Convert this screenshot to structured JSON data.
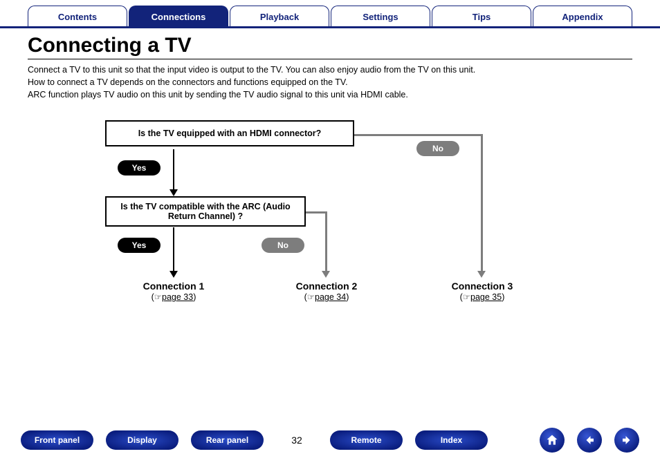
{
  "tabs": {
    "t0": "Contents",
    "t1": "Connections",
    "t2": "Playback",
    "t3": "Settings",
    "t4": "Tips",
    "t5": "Appendix",
    "active_index": 1
  },
  "heading": "Connecting a TV",
  "intro": {
    "p1": "Connect a TV to this unit so that the input video is output to the TV. You can also enjoy audio from the TV on this unit.",
    "p2": "How to connect a TV depends on the connectors and functions equipped on the TV.",
    "p3": "ARC function plays TV audio on this unit by sending the TV audio signal to this unit via HDMI cable."
  },
  "flow": {
    "q1": "Is the TV equipped with an HDMI connector?",
    "q2": "Is the TV compatible with the ARC (Audio Return Channel) ?",
    "yes": "Yes",
    "no": "No",
    "conn1_title": "Connection 1",
    "conn1_link": "page 33",
    "conn2_title": "Connection 2",
    "conn2_link": "page 34",
    "conn3_title": "Connection 3",
    "conn3_link": "page 35",
    "link_icon": "☞"
  },
  "page_number": "32",
  "bottom_nav": {
    "front": "Front panel",
    "display": "Display",
    "rear": "Rear panel",
    "remote": "Remote",
    "index": "Index"
  },
  "icons": {
    "home": "home-icon",
    "prev": "arrow-left-icon",
    "next": "arrow-right-icon"
  }
}
